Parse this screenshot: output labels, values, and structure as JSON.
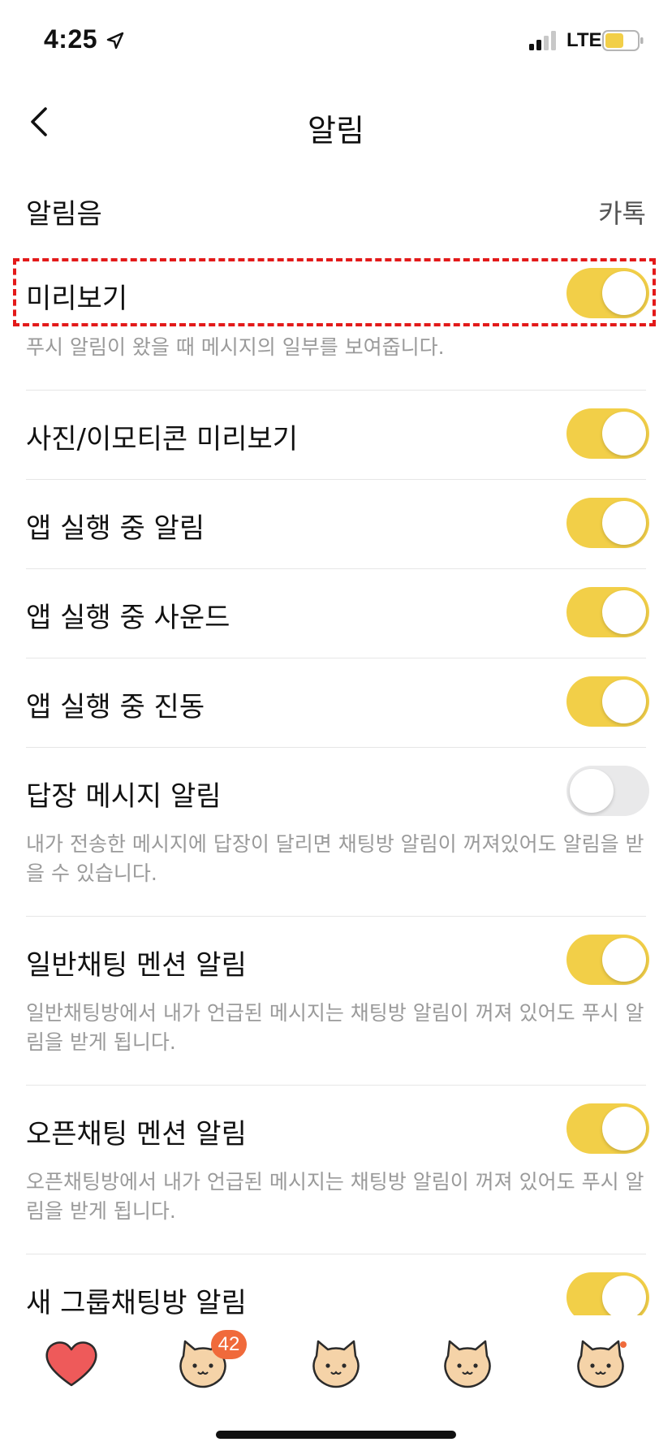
{
  "status_bar": {
    "time": "4:25",
    "network": "LTE"
  },
  "nav": {
    "title": "알림"
  },
  "sound_row": {
    "label": "알림음",
    "value": "카톡"
  },
  "settings": [
    {
      "label": "미리보기",
      "on": true,
      "description": "푸시 알림이 왔을 때 메시지의 일부를 보여줍니다."
    },
    {
      "label": "사진/이모티콘 미리보기",
      "on": true,
      "description": ""
    },
    {
      "label": "앱 실행 중 알림",
      "on": true,
      "description": ""
    },
    {
      "label": "앱 실행 중 사운드",
      "on": true,
      "description": ""
    },
    {
      "label": "앱 실행 중 진동",
      "on": true,
      "description": ""
    },
    {
      "label": "답장 메시지 알림",
      "on": false,
      "description": "내가 전송한 메시지에 답장이 달리면 채팅방 알림이 꺼져있어도 알림을 받을 수 있습니다."
    },
    {
      "label": "일반채팅 멘션 알림",
      "on": true,
      "description": "일반채팅방에서 내가 언급된 메시지는 채팅방 알림이 꺼져 있어도 푸시 알림을 받게 됩니다."
    },
    {
      "label": "오픈채팅 멘션 알림",
      "on": true,
      "description": "오픈채팅방에서 내가 언급된 메시지는 채팅방 알림이 꺼져 있어도 푸시 알림을 받게 됩니다."
    },
    {
      "label": "새 그룹채팅방 알림",
      "on": true,
      "description": ""
    }
  ],
  "tab_bar": {
    "tabs": [
      {
        "icon": "heart-icon"
      },
      {
        "icon": "cat-face-icon",
        "badge": "42"
      },
      {
        "icon": "cat-face-icon"
      },
      {
        "icon": "cat-face-icon"
      },
      {
        "icon": "cat-face-icon",
        "dot": true
      }
    ]
  },
  "colors": {
    "toggle_on": "#f2cf48",
    "toggle_off": "#e9e9ea",
    "highlight": "#e31a1a",
    "badge": "#f06a3b",
    "heart": "#ee5a5a",
    "cat": "#f5d3a8"
  }
}
